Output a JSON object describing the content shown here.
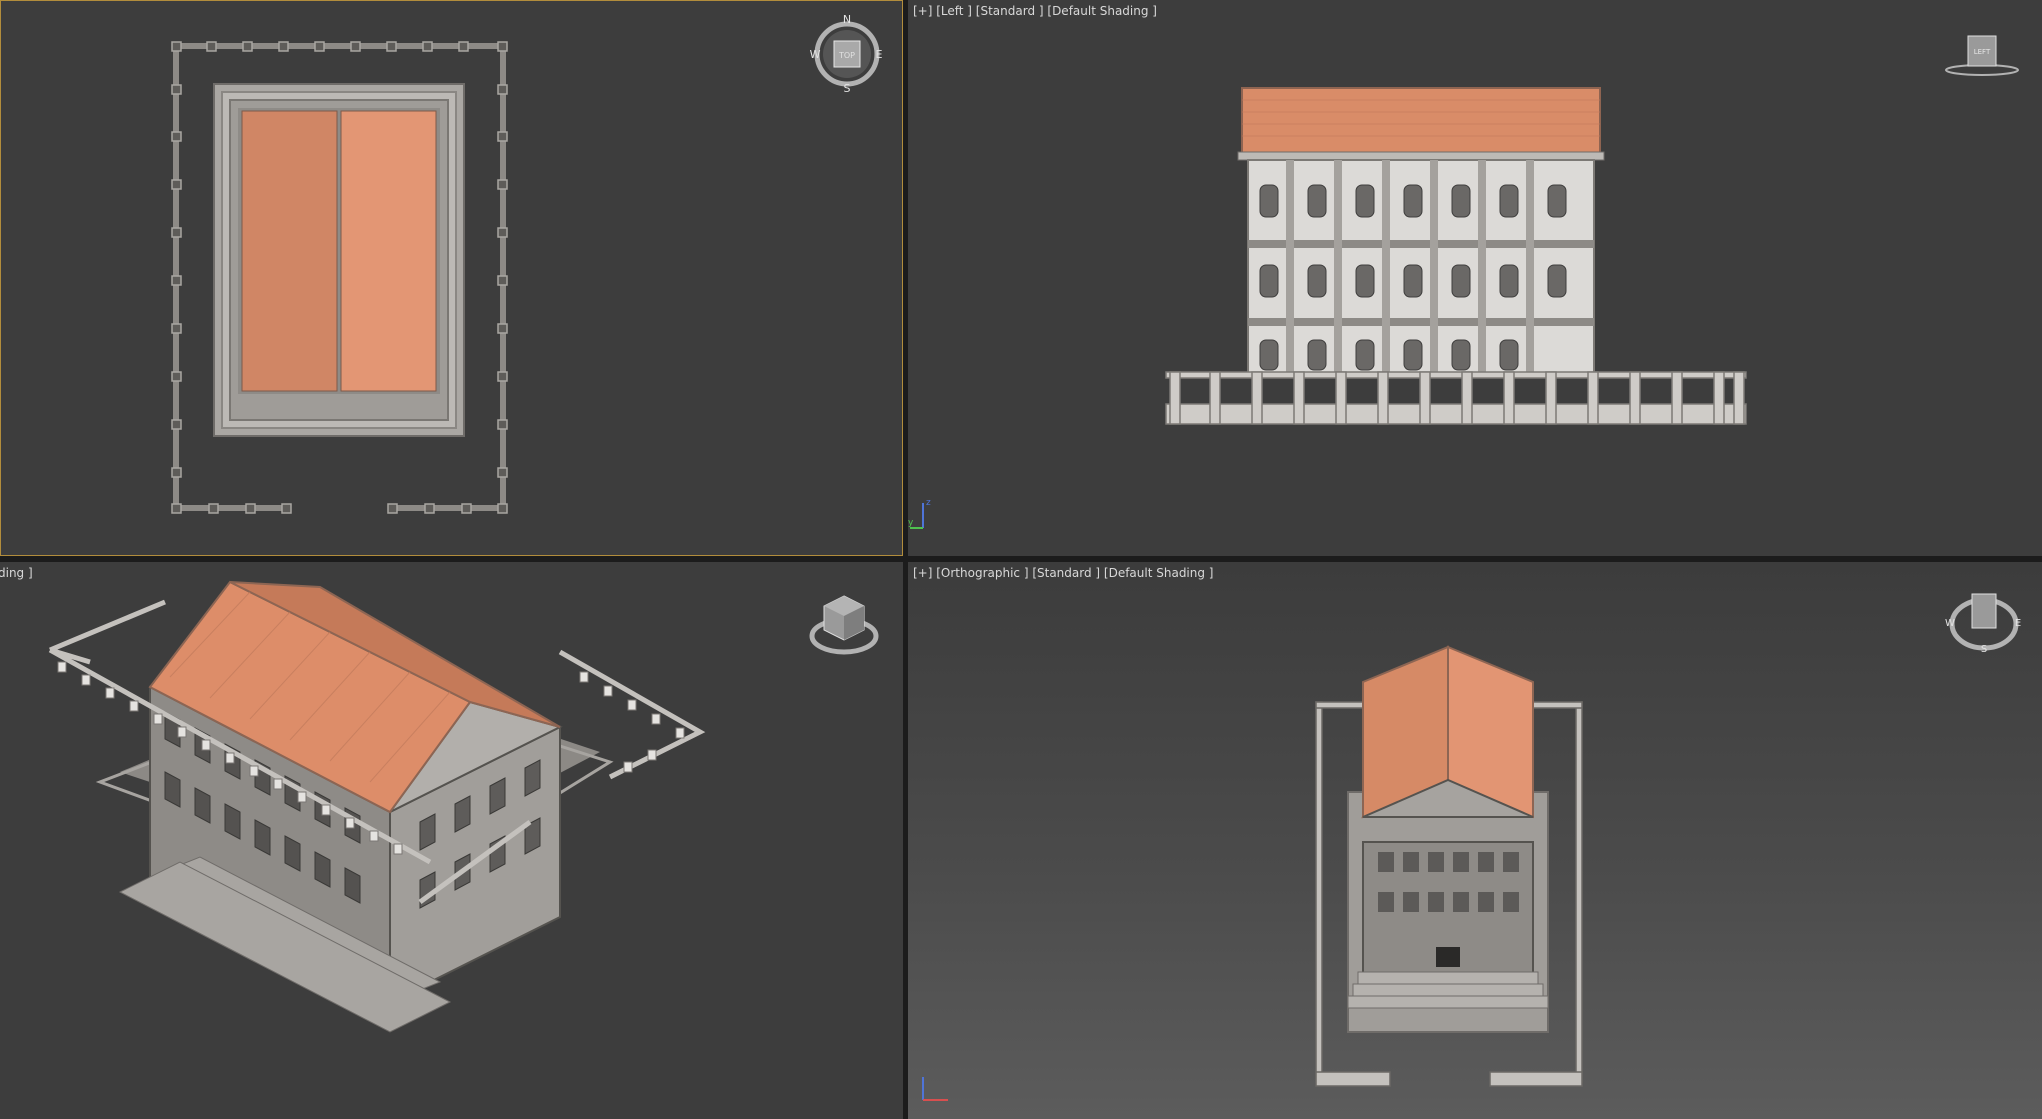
{
  "viewports": {
    "top": {
      "label": ""
    },
    "left": {
      "label": "[+] [Left ] [Standard ] [Default Shading ]"
    },
    "perspective": {
      "label": "ding ]"
    },
    "orthographic": {
      "label": "[+] [Orthographic ] [Standard ] [Default Shading ]"
    }
  },
  "viewcube": {
    "top": {
      "face": "TOP",
      "north": "N",
      "south": "S",
      "east": "E",
      "west": "W"
    },
    "left": {
      "face": "LEFT"
    },
    "ortho": {
      "east": "E",
      "west": "W",
      "south": "S"
    }
  },
  "axes": {
    "x": "x",
    "y": "y",
    "z": "z"
  },
  "colors": {
    "viewport_bg": "#3d3d3d",
    "active_border": "#b28d3c",
    "roof": "#d68a66",
    "stone": "#b9b6b1",
    "dark_stone": "#7d7a76"
  },
  "icons": [
    "viewcube-compass-icon",
    "axis-tripod-icon"
  ]
}
